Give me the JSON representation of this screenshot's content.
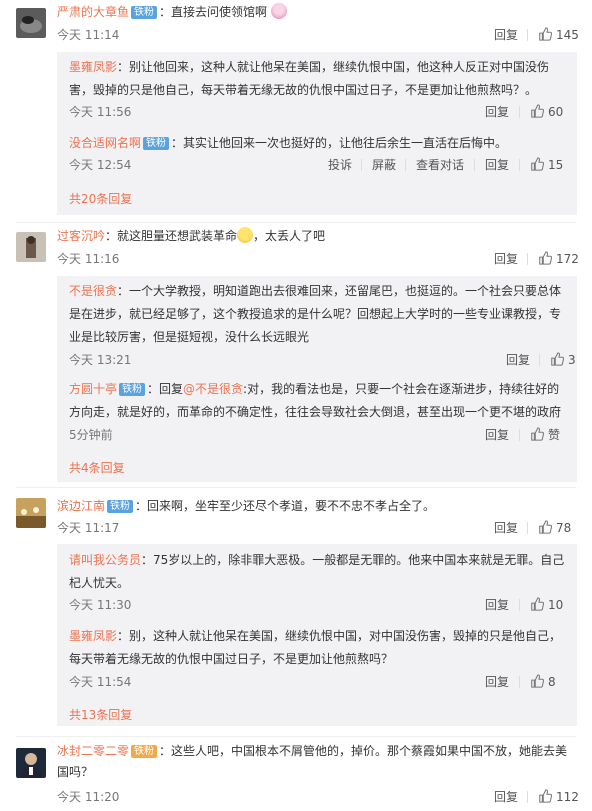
{
  "comments": [
    {
      "user": "严肃的大章鱼",
      "badge": "铁粉",
      "text": "：直接去问使领馆啊",
      "time": "今天 11:14",
      "reply": "回复",
      "likes": "145",
      "replies": [
        {
          "user": "墨雍凤影",
          "text1": "：别让他回来，这种人就让他呆在美国，继续仇恨中国，他这种人反正对中国没伤",
          "text2": "害，毁掉的只是他自己，每天带着无缘无故的仇恨中国过日子，不是更加让他煎熬吗？。",
          "time": "今天 11:56",
          "reply": "回复",
          "likes": "60"
        },
        {
          "user": "没合适网名啊",
          "badge": "铁粉",
          "text1": "：其实让他回来一次也挺好的，让他往后余生一直活在后悔中。",
          "time": "今天 12:54",
          "report": "投诉",
          "block": "屏蔽",
          "view": "查看对话",
          "reply": "回复",
          "likes": "15"
        }
      ],
      "more": "共20条回复"
    },
    {
      "user": "过客沉吟",
      "text_pre": "：就这胆量还想武装革命",
      "text_post": "，太丢人了吧",
      "time": "今天 11:16",
      "reply": "回复",
      "likes": "172",
      "replies": [
        {
          "user": "不是很贪",
          "text1": "：一个大学教授，明知道跑出去很难回来，还留尾巴，也挺逗的。一个社会只要总体",
          "text2": "是在进步，就已经足够了，这个教授追求的是什么呢？回想起上大学时的一些专业课教授，专",
          "text3": "业是比较厉害，但是挺短视，没什么长远眼光",
          "time": "今天 13:21",
          "reply": "回复",
          "likes": "3"
        },
        {
          "user": "方圆十亭",
          "badge": "铁粉",
          "text1_pre": "：回复",
          "mention": "@不是很贪",
          "text1_post": ":对，我的看法也是，只要一个社会在逐渐进步，持续往好的",
          "text2": "方向走，就是好的，而革命的不确定性，往往会导致社会大倒退，甚至出现一个更不堪的政府",
          "time": "5分钟前",
          "reply": "回复",
          "likes": "赞"
        }
      ],
      "more": "共4条回复"
    },
    {
      "user": "滨边江南",
      "badge": "铁粉",
      "text": "：回来啊，坐牢至少还尽个孝道，要不不忠不孝占全了。",
      "time": "今天 11:17",
      "reply": "回复",
      "likes": "78",
      "replies": [
        {
          "user": "请叫我公务员",
          "text1": "：75岁以上的，除非罪大恶极。一般都是无罪的。他来中国本来就是无罪。自己",
          "text2": "杞人忧天。",
          "time": "今天 11:30",
          "reply": "回复",
          "likes": "10"
        },
        {
          "user": "墨雍凤影",
          "text1": "：别，这种人就让他呆在美国，继续仇恨中国，对中国没伤害，毁掉的只是他自己，",
          "text2": "每天带着无缘无故的仇恨中国过日子，不是更加让他煎熬吗？",
          "time": "今天 11:54",
          "reply": "回复",
          "likes": "8"
        }
      ],
      "more": "共13条回复"
    },
    {
      "user": "冰封二零二零",
      "badge": "铁粉",
      "text1": "：这些人吧，中国根本不屑管他的，掉价。那个蔡霞如果中国不放，她能去美",
      "text2": "国吗？",
      "time": "今天 11:20",
      "reply": "回复",
      "likes": "112"
    }
  ],
  "colors": {
    "username": "#eb7350",
    "badge": "#5aa2e0",
    "reply_bg": "#f2f2f5"
  }
}
